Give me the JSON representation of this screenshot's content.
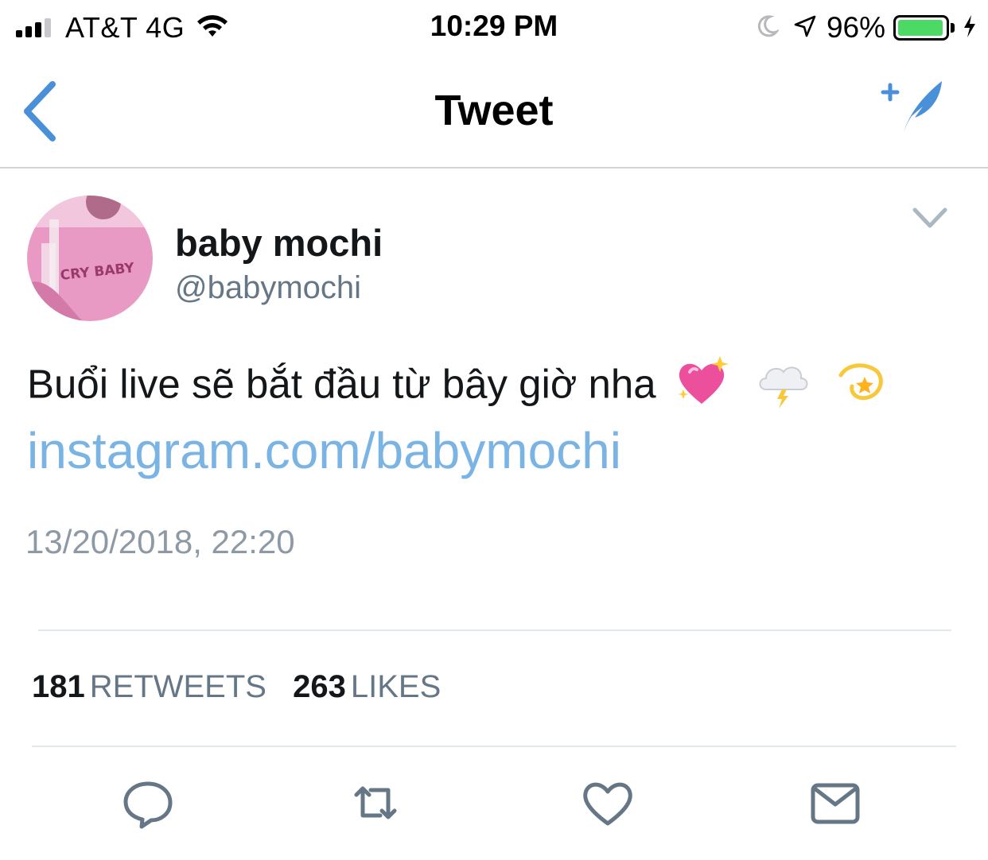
{
  "status_bar": {
    "carrier": "AT&T 4G",
    "time": "10:29 PM",
    "battery_percent": "96%",
    "battery_level": 0.96,
    "signal_bars_filled": 3,
    "signal_bars_total": 4,
    "icons": [
      "signal-icon",
      "wifi-icon",
      "moon-icon",
      "location-arrow-icon",
      "battery-icon",
      "charging-bolt-icon"
    ],
    "battery_color": "#4cd964"
  },
  "nav": {
    "title": "Tweet",
    "back_icon": "chevron-left-icon",
    "compose_icon": "compose-quill-icon",
    "accent_color": "#4a90d9"
  },
  "tweet": {
    "display_name": "baby mochi",
    "handle": "@babymochi",
    "text": "Buổi live sẽ bắt đầu từ bây giờ nha",
    "emojis": [
      "💖",
      "🌩️",
      "💫"
    ],
    "link": "instagram.com/babymochi",
    "link_color": "#7ab4e4",
    "timestamp": "13/20/2018, 22:20",
    "avatar_text": "CRY BABY",
    "avatar_color": "#e89ac4"
  },
  "stats": {
    "retweets_count": "181",
    "retweets_label": "RETWEETS",
    "likes_count": "263",
    "likes_label": "LIKES"
  },
  "actions": [
    "reply-icon",
    "retweet-icon",
    "like-icon",
    "direct-message-icon"
  ]
}
